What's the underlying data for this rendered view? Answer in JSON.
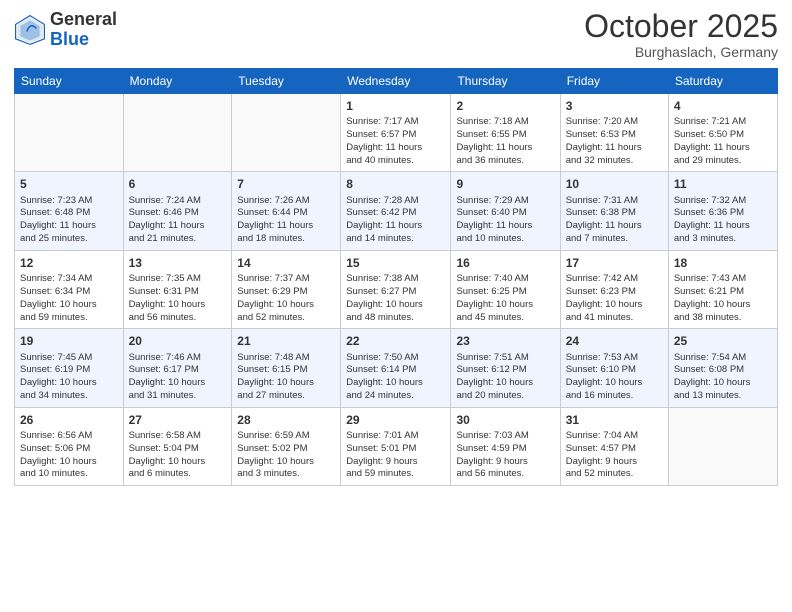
{
  "logo": {
    "general": "General",
    "blue": "Blue"
  },
  "header": {
    "month": "October 2025",
    "location": "Burghaslach, Germany"
  },
  "weekdays": [
    "Sunday",
    "Monday",
    "Tuesday",
    "Wednesday",
    "Thursday",
    "Friday",
    "Saturday"
  ],
  "weeks": [
    [
      {
        "day": "",
        "info": ""
      },
      {
        "day": "",
        "info": ""
      },
      {
        "day": "",
        "info": ""
      },
      {
        "day": "1",
        "info": "Sunrise: 7:17 AM\nSunset: 6:57 PM\nDaylight: 11 hours\nand 40 minutes."
      },
      {
        "day": "2",
        "info": "Sunrise: 7:18 AM\nSunset: 6:55 PM\nDaylight: 11 hours\nand 36 minutes."
      },
      {
        "day": "3",
        "info": "Sunrise: 7:20 AM\nSunset: 6:53 PM\nDaylight: 11 hours\nand 32 minutes."
      },
      {
        "day": "4",
        "info": "Sunrise: 7:21 AM\nSunset: 6:50 PM\nDaylight: 11 hours\nand 29 minutes."
      }
    ],
    [
      {
        "day": "5",
        "info": "Sunrise: 7:23 AM\nSunset: 6:48 PM\nDaylight: 11 hours\nand 25 minutes."
      },
      {
        "day": "6",
        "info": "Sunrise: 7:24 AM\nSunset: 6:46 PM\nDaylight: 11 hours\nand 21 minutes."
      },
      {
        "day": "7",
        "info": "Sunrise: 7:26 AM\nSunset: 6:44 PM\nDaylight: 11 hours\nand 18 minutes."
      },
      {
        "day": "8",
        "info": "Sunrise: 7:28 AM\nSunset: 6:42 PM\nDaylight: 11 hours\nand 14 minutes."
      },
      {
        "day": "9",
        "info": "Sunrise: 7:29 AM\nSunset: 6:40 PM\nDaylight: 11 hours\nand 10 minutes."
      },
      {
        "day": "10",
        "info": "Sunrise: 7:31 AM\nSunset: 6:38 PM\nDaylight: 11 hours\nand 7 minutes."
      },
      {
        "day": "11",
        "info": "Sunrise: 7:32 AM\nSunset: 6:36 PM\nDaylight: 11 hours\nand 3 minutes."
      }
    ],
    [
      {
        "day": "12",
        "info": "Sunrise: 7:34 AM\nSunset: 6:34 PM\nDaylight: 10 hours\nand 59 minutes."
      },
      {
        "day": "13",
        "info": "Sunrise: 7:35 AM\nSunset: 6:31 PM\nDaylight: 10 hours\nand 56 minutes."
      },
      {
        "day": "14",
        "info": "Sunrise: 7:37 AM\nSunset: 6:29 PM\nDaylight: 10 hours\nand 52 minutes."
      },
      {
        "day": "15",
        "info": "Sunrise: 7:38 AM\nSunset: 6:27 PM\nDaylight: 10 hours\nand 48 minutes."
      },
      {
        "day": "16",
        "info": "Sunrise: 7:40 AM\nSunset: 6:25 PM\nDaylight: 10 hours\nand 45 minutes."
      },
      {
        "day": "17",
        "info": "Sunrise: 7:42 AM\nSunset: 6:23 PM\nDaylight: 10 hours\nand 41 minutes."
      },
      {
        "day": "18",
        "info": "Sunrise: 7:43 AM\nSunset: 6:21 PM\nDaylight: 10 hours\nand 38 minutes."
      }
    ],
    [
      {
        "day": "19",
        "info": "Sunrise: 7:45 AM\nSunset: 6:19 PM\nDaylight: 10 hours\nand 34 minutes."
      },
      {
        "day": "20",
        "info": "Sunrise: 7:46 AM\nSunset: 6:17 PM\nDaylight: 10 hours\nand 31 minutes."
      },
      {
        "day": "21",
        "info": "Sunrise: 7:48 AM\nSunset: 6:15 PM\nDaylight: 10 hours\nand 27 minutes."
      },
      {
        "day": "22",
        "info": "Sunrise: 7:50 AM\nSunset: 6:14 PM\nDaylight: 10 hours\nand 24 minutes."
      },
      {
        "day": "23",
        "info": "Sunrise: 7:51 AM\nSunset: 6:12 PM\nDaylight: 10 hours\nand 20 minutes."
      },
      {
        "day": "24",
        "info": "Sunrise: 7:53 AM\nSunset: 6:10 PM\nDaylight: 10 hours\nand 16 minutes."
      },
      {
        "day": "25",
        "info": "Sunrise: 7:54 AM\nSunset: 6:08 PM\nDaylight: 10 hours\nand 13 minutes."
      }
    ],
    [
      {
        "day": "26",
        "info": "Sunrise: 6:56 AM\nSunset: 5:06 PM\nDaylight: 10 hours\nand 10 minutes."
      },
      {
        "day": "27",
        "info": "Sunrise: 6:58 AM\nSunset: 5:04 PM\nDaylight: 10 hours\nand 6 minutes."
      },
      {
        "day": "28",
        "info": "Sunrise: 6:59 AM\nSunset: 5:02 PM\nDaylight: 10 hours\nand 3 minutes."
      },
      {
        "day": "29",
        "info": "Sunrise: 7:01 AM\nSunset: 5:01 PM\nDaylight: 9 hours\nand 59 minutes."
      },
      {
        "day": "30",
        "info": "Sunrise: 7:03 AM\nSunset: 4:59 PM\nDaylight: 9 hours\nand 56 minutes."
      },
      {
        "day": "31",
        "info": "Sunrise: 7:04 AM\nSunset: 4:57 PM\nDaylight: 9 hours\nand 52 minutes."
      },
      {
        "day": "",
        "info": ""
      }
    ]
  ]
}
